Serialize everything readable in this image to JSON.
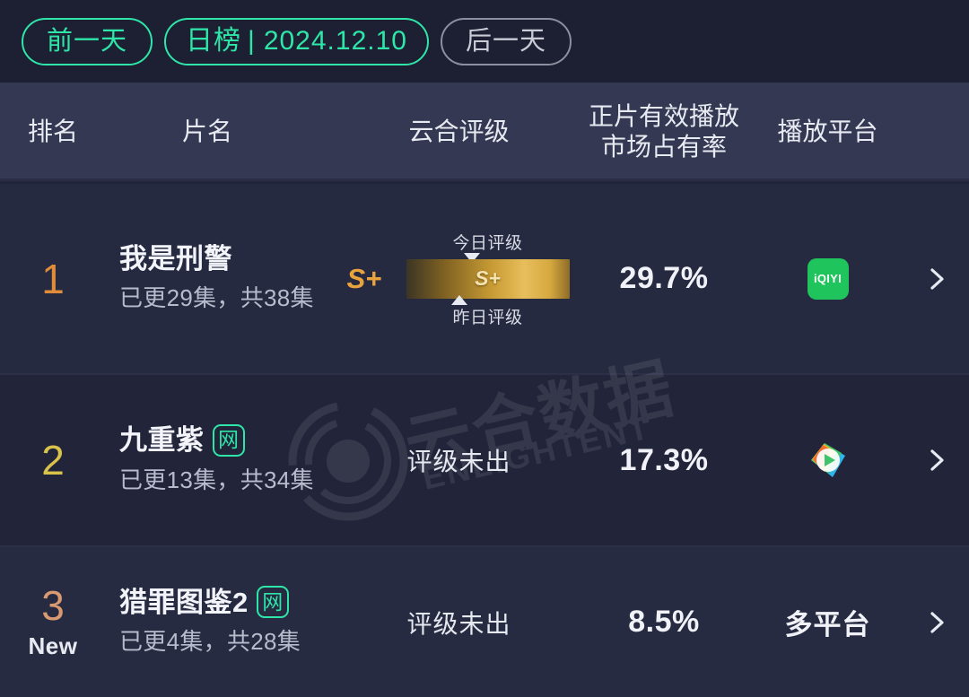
{
  "datebar": {
    "prev_label": "前一天",
    "current_prefix": "日榜",
    "separator": "|",
    "current_date": "2024.12.10",
    "next_label": "后一天",
    "accent_color": "#2ee6a8",
    "dim_color": "#c9ccd6"
  },
  "table": {
    "columns": [
      {
        "key": "rank",
        "label": "排名"
      },
      {
        "key": "title",
        "label": "片名"
      },
      {
        "key": "rating",
        "label": "云合评级"
      },
      {
        "key": "share",
        "label": "正片有效播放\n市场占有率",
        "line1": "正片有效播放",
        "line2": "市场占有率"
      },
      {
        "key": "platform",
        "label": "播放平台"
      }
    ],
    "rows": [
      {
        "rank": "1",
        "rank_color": "#e08c3a",
        "rank_badge": "",
        "title": "我是刑警",
        "web_badge": "",
        "has_web_badge": false,
        "subtitle": "已更29集，共38集",
        "rating_type": "graph",
        "rating_letter": "S+",
        "rating_bar_text": "S+",
        "rating_label_today": "今日评级",
        "rating_label_yesterday": "昨日评级",
        "rating_text": "",
        "share": "29.7%",
        "platform_type": "iqiyi",
        "platform_icon": "iqiyi-logo",
        "platform_icon_text": "iQIYI",
        "platform_text": "",
        "chevron": "chevron-right-icon"
      },
      {
        "rank": "2",
        "rank_color": "#d8c24a",
        "rank_badge": "",
        "title": "九重紫",
        "web_badge": "网",
        "has_web_badge": true,
        "subtitle": "已更13集，共34集",
        "rating_type": "text",
        "rating_letter": "",
        "rating_bar_text": "",
        "rating_label_today": "",
        "rating_label_yesterday": "",
        "rating_text": "评级未出",
        "share": "17.3%",
        "platform_type": "tencent",
        "platform_icon": "tencent-video-logo",
        "platform_icon_text": "",
        "platform_text": "",
        "chevron": "chevron-right-icon"
      },
      {
        "rank": "3",
        "rank_color": "#d99a72",
        "rank_badge": "New",
        "title": "猎罪图鉴2",
        "web_badge": "网",
        "has_web_badge": true,
        "subtitle": "已更4集，共28集",
        "rating_type": "text",
        "rating_letter": "",
        "rating_bar_text": "",
        "rating_label_today": "",
        "rating_label_yesterday": "",
        "rating_text": "评级未出",
        "share": "8.5%",
        "platform_type": "text",
        "platform_icon": "",
        "platform_icon_text": "",
        "platform_text": "多平台",
        "chevron": "chevron-right-icon"
      }
    ]
  },
  "watermark": {
    "brand": "云合数据",
    "brand_en": "ENLIGHTENT",
    "logo": "enlightent-ring-logo"
  }
}
